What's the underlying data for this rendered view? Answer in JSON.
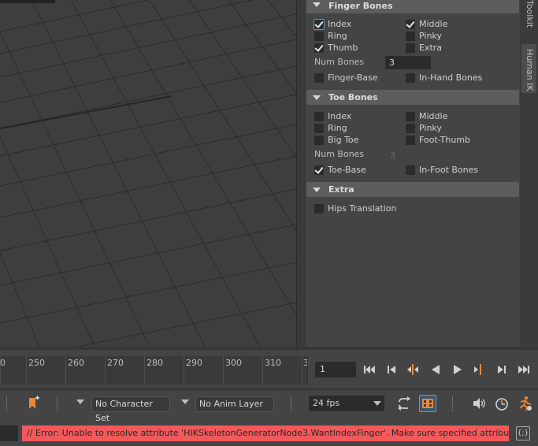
{
  "panel": {
    "finger_bones": {
      "title": "Finger Bones",
      "checkboxes": [
        {
          "label": "Index",
          "checked": true
        },
        {
          "label": "Middle",
          "checked": true
        },
        {
          "label": "Ring",
          "checked": false
        },
        {
          "label": "Pinky",
          "checked": false
        },
        {
          "label": "Thumb",
          "checked": true
        },
        {
          "label": "Extra",
          "checked": false
        }
      ],
      "num_bones_label": "Num Bones",
      "num_bones_value": "3",
      "finger_base_label": "Finger-Base",
      "in_hand_label": "In-Hand Bones"
    },
    "toe_bones": {
      "title": "Toe Bones",
      "checkboxes": [
        {
          "label": "Index",
          "checked": false
        },
        {
          "label": "Middle",
          "checked": false
        },
        {
          "label": "Ring",
          "checked": false
        },
        {
          "label": "Pinky",
          "checked": false
        },
        {
          "label": "Big Toe",
          "checked": false
        },
        {
          "label": "Foot-Thumb",
          "checked": false
        }
      ],
      "num_bones_label": "Num Bones",
      "num_bones_value": "3",
      "toe_base_label": "Toe-Base",
      "in_foot_label": "In-Foot Bones"
    },
    "extra": {
      "title": "Extra",
      "hips_label": "Hips Translation"
    }
  },
  "side_tabs": {
    "toolkit": "Toolkit",
    "human_ik": "Human IK"
  },
  "timeline": {
    "tick_labels": [
      "0",
      "250",
      "260",
      "270",
      "280",
      "290",
      "300",
      "310",
      "3"
    ],
    "current_frame": "1"
  },
  "lower_bar": {
    "character_set": "No Character Set",
    "anim_layer": "No Anim Layer",
    "fps": "24 fps"
  },
  "status": {
    "error_text": "// Error: Unable to resolve attribute 'HIKSkeletonGeneratorNode3.WantIndexFinger'. Make sure specified attributes are"
  },
  "colors": {
    "error_bg": "#f25a5a",
    "accent": "#e8873a"
  }
}
